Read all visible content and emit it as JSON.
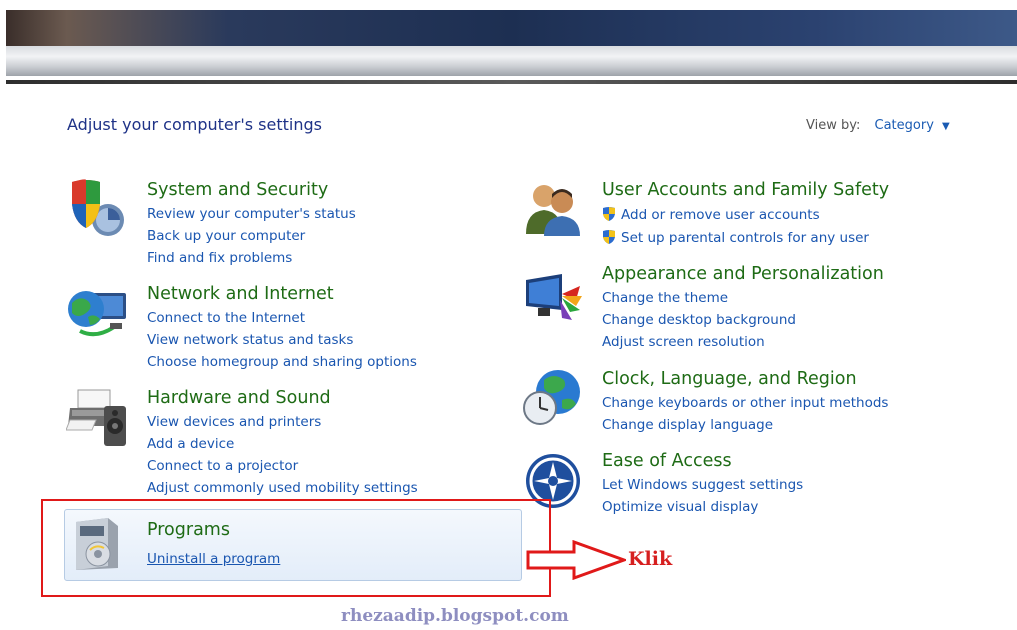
{
  "heading": "Adjust your computer's settings",
  "view_by": {
    "label": "View by:",
    "value": "Category"
  },
  "left_categories": [
    {
      "title": "System and Security",
      "links": [
        "Review your computer's status",
        "Back up your computer",
        "Find and fix problems"
      ]
    },
    {
      "title": "Network and Internet",
      "links": [
        "Connect to the Internet",
        "View network status and tasks",
        "Choose homegroup and sharing options"
      ]
    },
    {
      "title": "Hardware and Sound",
      "links": [
        "View devices and printers",
        "Add a device",
        "Connect to a projector",
        "Adjust commonly used mobility settings"
      ]
    },
    {
      "title": "Programs",
      "links": [
        "Uninstall a program"
      ]
    }
  ],
  "right_categories": [
    {
      "title": "User Accounts and Family Safety",
      "links": [
        "Add or remove user accounts",
        "Set up parental controls for any user"
      ]
    },
    {
      "title": "Appearance and Personalization",
      "links": [
        "Change the theme",
        "Change desktop background",
        "Adjust screen resolution"
      ]
    },
    {
      "title": "Clock, Language, and Region",
      "links": [
        "Change keyboards or other input methods",
        "Change display language"
      ]
    },
    {
      "title": "Ease of Access",
      "links": [
        "Let Windows suggest settings",
        "Optimize visual display"
      ]
    }
  ],
  "annotation": {
    "text": "Klik",
    "color": "#d61f1f"
  },
  "watermark": "rhezaadip.blogspot.com",
  "colors": {
    "category_title": "#1e6b15",
    "link": "#1a56b0",
    "heading": "#1e3287",
    "highlight_border": "#e01919"
  },
  "icons": [
    "shield-pc-icon",
    "network-globe-icon",
    "printer-speaker-icon",
    "programs-box-icon",
    "users-icon",
    "monitor-palette-icon",
    "globe-clock-icon",
    "ease-of-access-icon",
    "uac-shield-icon"
  ]
}
